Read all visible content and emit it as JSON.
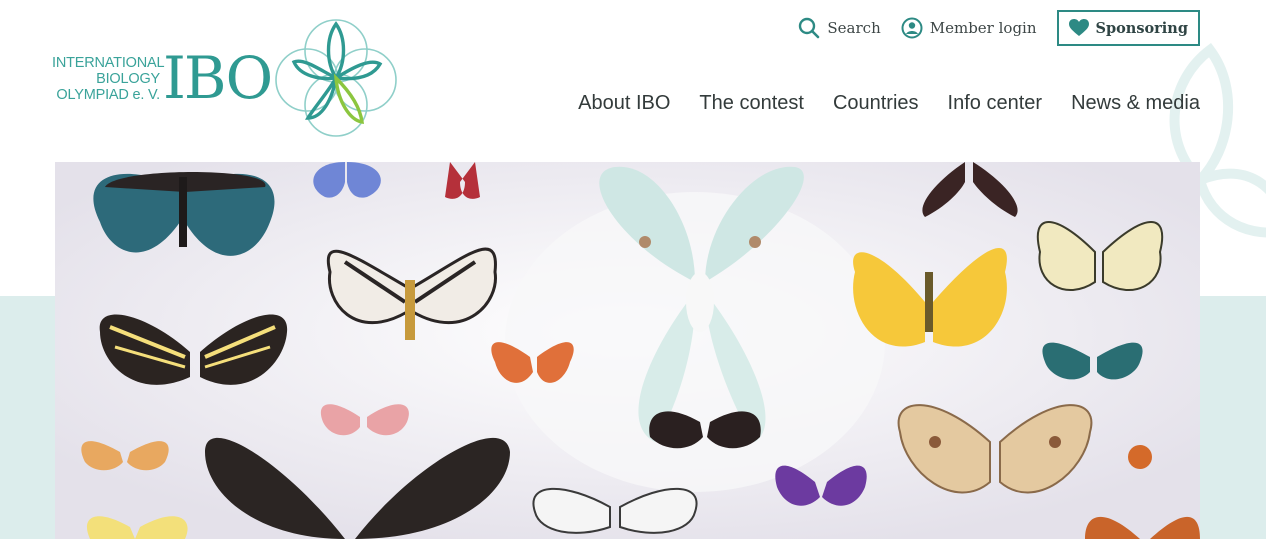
{
  "logo": {
    "line1": "INTERNATIONAL",
    "line2": "BIOLOGY",
    "line3": "OLYMPIAD e. V.",
    "acronym": "IBO"
  },
  "utility_nav": {
    "search_label": "Search",
    "member_login_label": "Member login",
    "sponsoring_label": "Sponsoring"
  },
  "main_nav": {
    "items": [
      "About IBO",
      "The contest",
      "Countries",
      "Info center",
      "News & media"
    ]
  },
  "colors": {
    "brand_teal": "#2f9a92",
    "brand_green": "#8cc63f",
    "band_bg": "#dcedec"
  },
  "icons": {
    "search": "search-icon",
    "member": "user-circle-icon",
    "sponsor": "heart-icon"
  },
  "hero": {
    "image": "butterfly-specimen-collection"
  }
}
